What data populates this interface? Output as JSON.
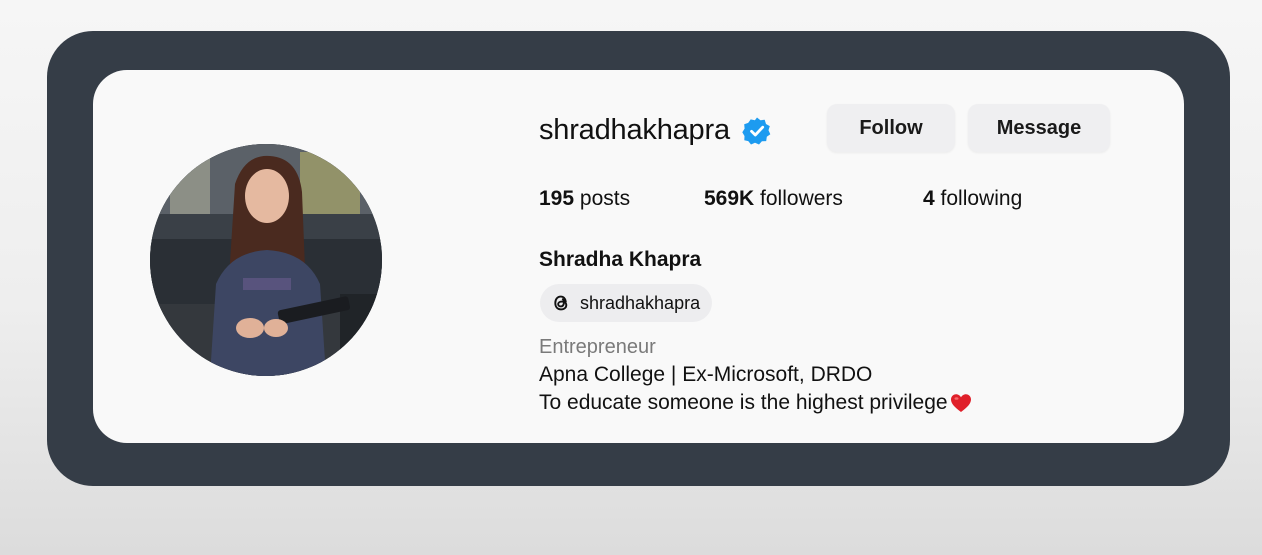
{
  "profile": {
    "username": "shradhakhapra",
    "verified": true,
    "full_name": "Shradha Khapra",
    "threads_handle": "shradhakhapra",
    "category": "Entrepreneur",
    "bio_line1": "Apna College | Ex-Microsoft, DRDO",
    "bio_line2": "To educate someone is the highest privilege",
    "bio_emoji": "red-heart-icon"
  },
  "actions": {
    "follow_label": "Follow",
    "message_label": "Message"
  },
  "stats": {
    "posts_count": "195",
    "posts_label": "posts",
    "followers_count": "569K",
    "followers_label": "followers",
    "following_count": "4",
    "following_label": "following"
  },
  "colors": {
    "frame": "#353d47",
    "card": "#f9f9f9",
    "verified_badge": "#1d9bf0",
    "button_bg": "#efeff1",
    "category_text": "#7a7a7a",
    "heart": "#e0202a"
  },
  "icons": {
    "verified": "verified-badge-icon",
    "threads": "threads-icon",
    "heart": "red-heart-icon"
  }
}
